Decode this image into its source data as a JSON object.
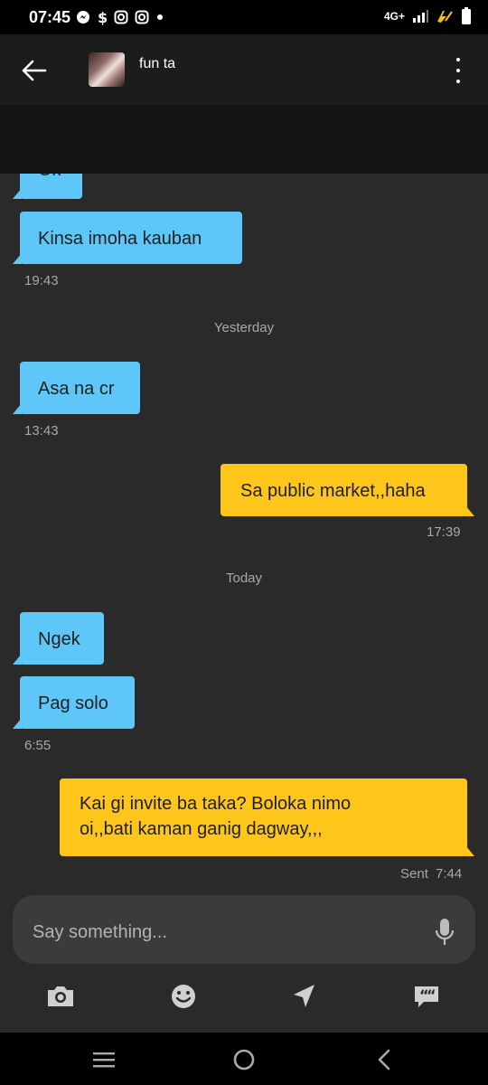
{
  "status_bar": {
    "time": "07:45",
    "network": "4G+"
  },
  "header": {
    "contact_name": "fun ta"
  },
  "messages": [
    {
      "direction": "in",
      "text": "Ok"
    },
    {
      "direction": "in",
      "text": "Kinsa imoha kauban",
      "time": "19:43"
    },
    {
      "divider": "Yesterday"
    },
    {
      "direction": "in",
      "text": "Asa na cr",
      "time": "13:43"
    },
    {
      "direction": "out",
      "text": "Sa public market,,haha",
      "time": "17:39"
    },
    {
      "divider": "Today"
    },
    {
      "direction": "in",
      "text": "Ngek"
    },
    {
      "direction": "in",
      "text": "Pag solo",
      "time": "6:55"
    },
    {
      "direction": "out",
      "lines": [
        "Kai gi invite ba taka? Boloka nimo",
        "oi,,bati kaman ganig dagway,,,"
      ],
      "status": "Sent",
      "time": "7:44"
    }
  ],
  "composer": {
    "placeholder": "Say something..."
  },
  "icons": {
    "back": "arrow-left-icon",
    "more": "more-vertical-icon",
    "mic": "microphone-icon",
    "actions": [
      "camera-icon",
      "emoji-icon",
      "location-icon",
      "quick-replies-icon"
    ],
    "nav": [
      "recent-apps-icon",
      "home-icon",
      "back-icon"
    ]
  },
  "colors": {
    "incoming_bubble": "#5ec7f8",
    "outgoing_bubble": "#fec51b",
    "chat_background": "#2a2a2a",
    "header": "#1c1c1c"
  }
}
